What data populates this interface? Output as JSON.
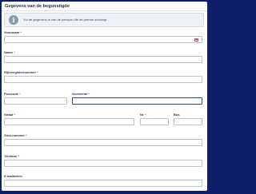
{
  "form": {
    "title": "Gegevens van de begunstigde",
    "info_text": "Vul de gegevens in van de persoon die de premie ontvangt.",
    "required_marker": "*",
    "fields": {
      "voornaam": "Voornaam",
      "naam": "Naam",
      "rijksregisternummer": "Rijksregisternummer",
      "postcode": "Postcode",
      "gemeente": "Gemeente",
      "straat": "Straat",
      "nr": "Nr",
      "bus": "Bus",
      "gsm_nummer": "Gsm-nummer",
      "telefoon": "Telefoon",
      "e_mailadres": "E-mailadres"
    }
  }
}
